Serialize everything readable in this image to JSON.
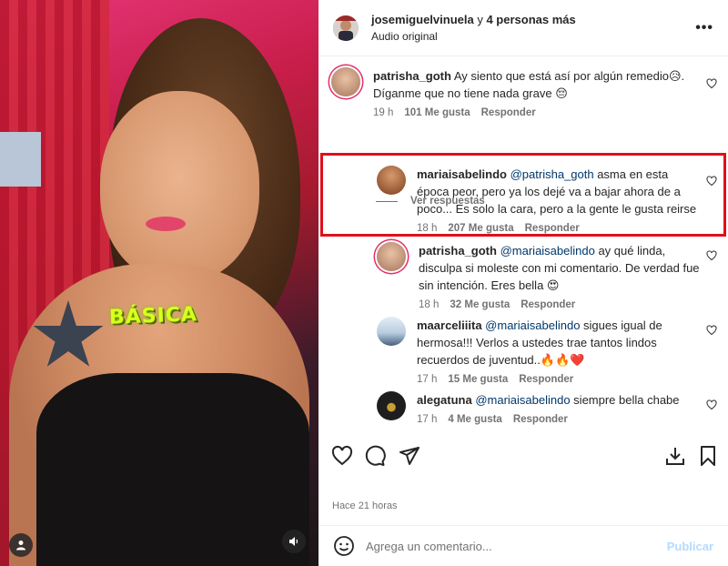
{
  "post": {
    "author": "josemiguelvinuela",
    "coauthors_connector": "y",
    "coauthors": "4 personas más",
    "audio": "Audio original",
    "more_icon": "more-horizontal-icon",
    "timestamp": "Hace 21 horas"
  },
  "media": {
    "sticker_text": "BÁSICA",
    "user_tags_icon": "user-icon",
    "audio_icon": "speaker-icon"
  },
  "comments": [
    {
      "username": "patrisha_goth",
      "text": "Ay siento que está así por algún remedio😥. Díganme que no tiene nada grave 😔",
      "mention": "",
      "time": "19 h",
      "likes": "101 Me gusta",
      "reply": "Responder",
      "avatar_color": "#c9a48a"
    },
    {
      "username": "mariaisabelindo",
      "mention": "@patrisha_goth",
      "text": " asma en esta época peor, pero ya los dejé va a bajar ahora de a poco... Es solo la cara, pero a la gente le gusta reirse",
      "time": "18 h",
      "likes": "207 Me gusta",
      "reply": "Responder",
      "avatar_color": "#b5683f"
    },
    {
      "username": "patrisha_goth",
      "mention": "@mariaisabelindo",
      "text": " ay qué linda, disculpa si moleste con mi comentario. De verdad fue sin intención. Eres bella 😍",
      "time": "18 h",
      "likes": "32 Me gusta",
      "reply": "Responder",
      "avatar_color": "#c9a48a"
    },
    {
      "username": "maarceliiita",
      "mention": "@mariaisabelindo",
      "text": " sigues igual de hermosa!!! Verlos a ustedes trae tantos lindos recuerdos de juventud..🔥🔥❤️",
      "time": "17 h",
      "likes": "15 Me gusta",
      "reply": "Responder",
      "avatar_color": "#8fa7c0"
    },
    {
      "username": "alegatuna",
      "mention": "@mariaisabelindo",
      "text": " siempre bella chabe",
      "time": "17 h",
      "likes": "4 Me gusta",
      "reply": "Responder",
      "avatar_color": "#1e1e1e"
    }
  ],
  "view_replies": "Ver respuestas",
  "add_comment": {
    "placeholder": "Agrega un comentario...",
    "publish": "Publicar"
  },
  "colors": {
    "highlight_border": "#e0101a",
    "mention": "#00376b",
    "publish_disabled": "#b3dbff"
  }
}
